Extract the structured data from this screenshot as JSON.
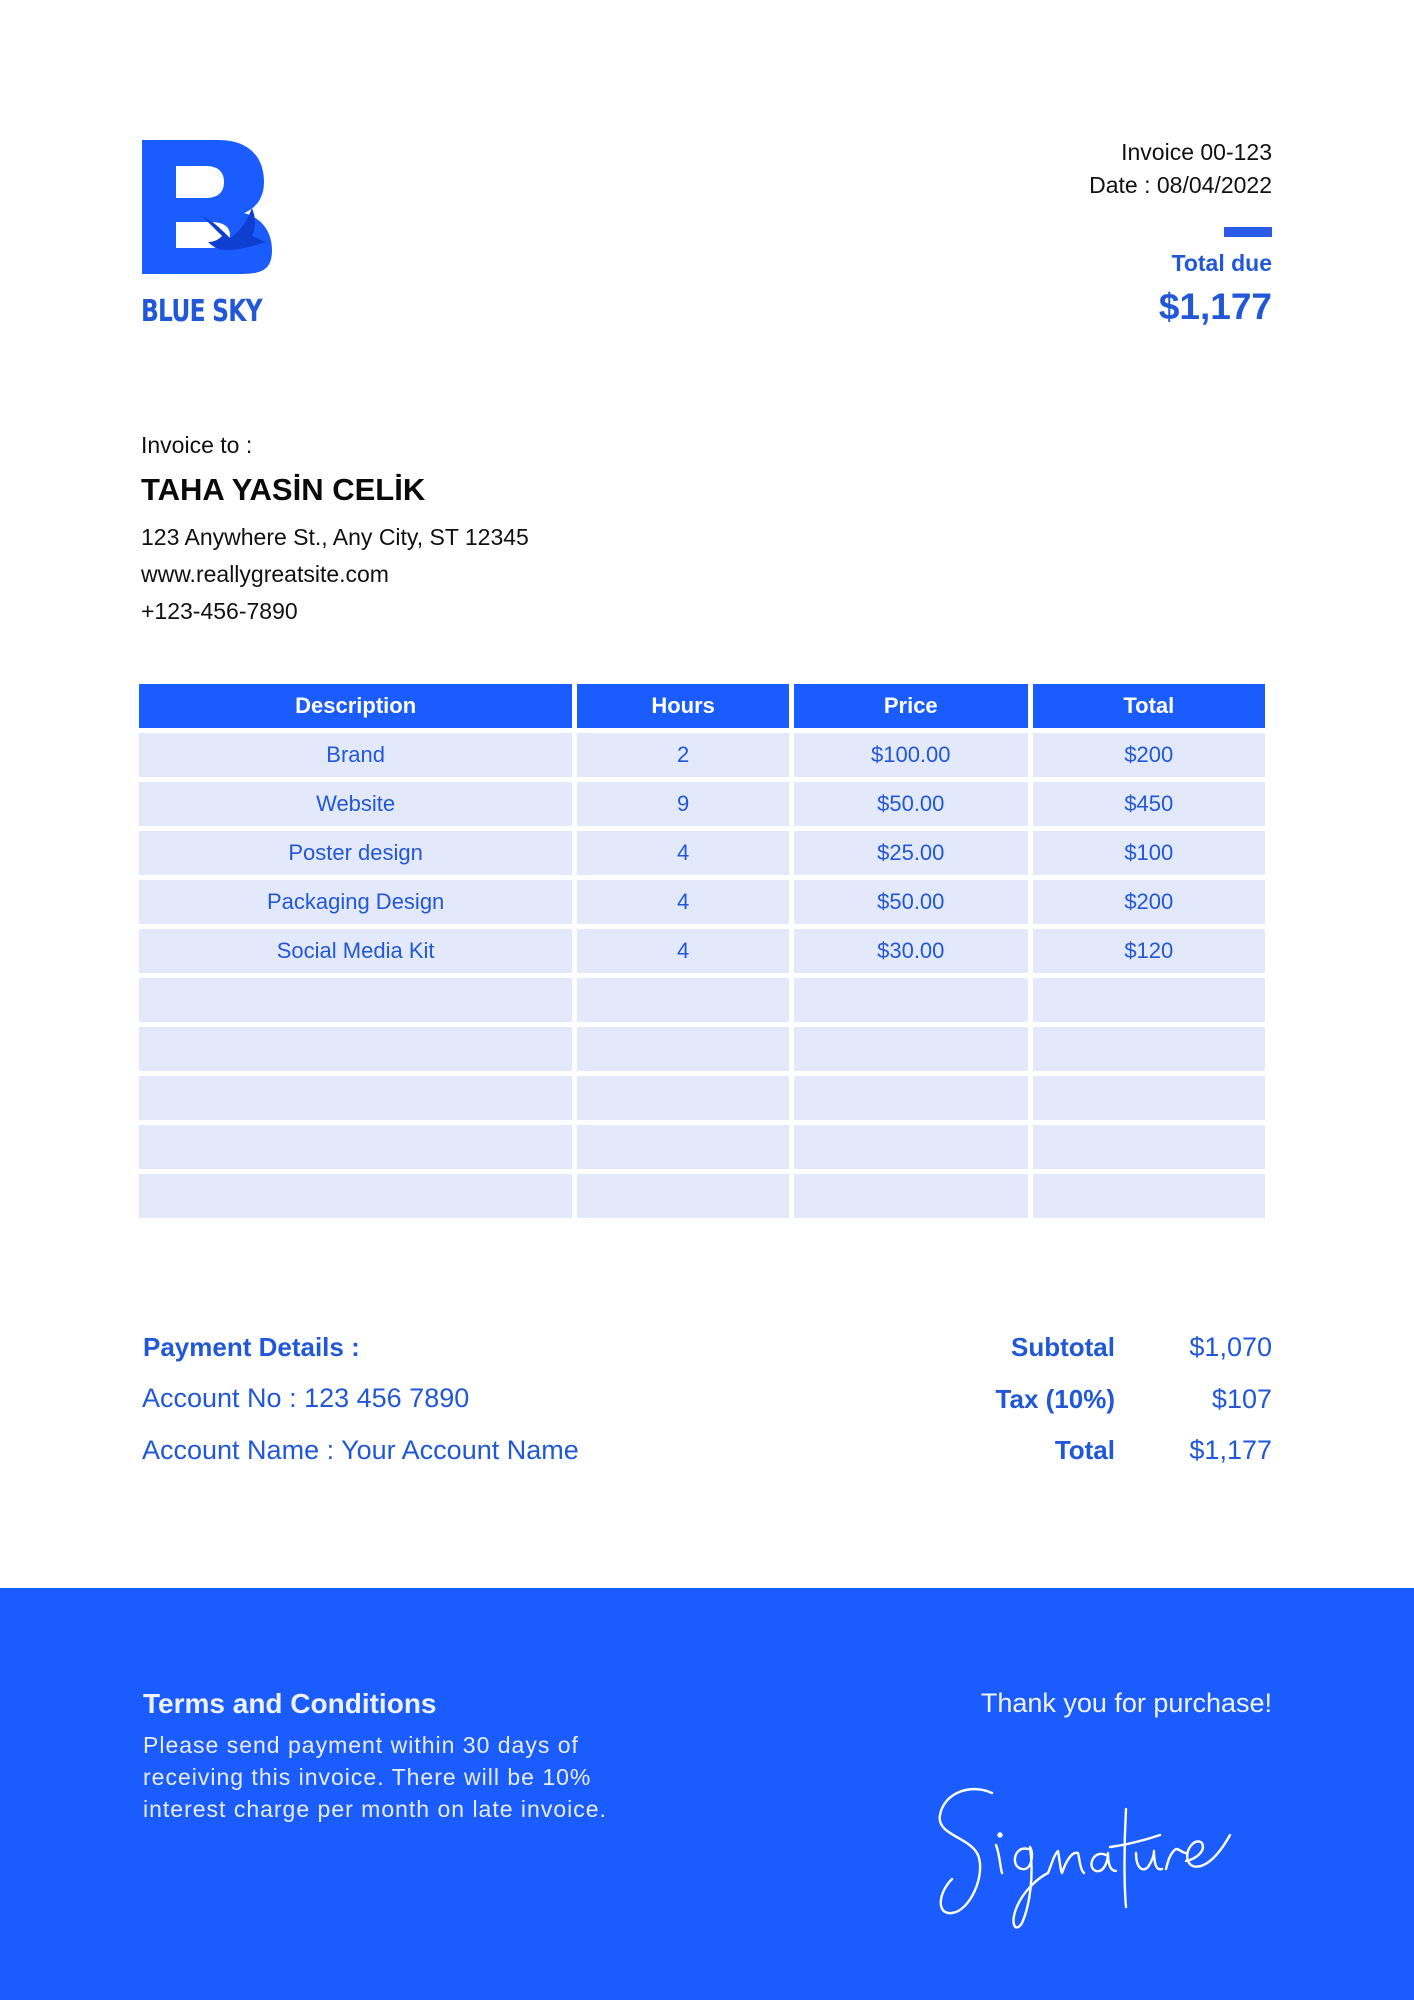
{
  "brand": {
    "name": "BLUE SKY",
    "logo_letter": "B",
    "logo_icon": "bird-icon",
    "color": "#1b5cff"
  },
  "invoice": {
    "number": "Invoice 00-123",
    "date": "Date : 08/04/2022",
    "total_due_label": "Total due",
    "total_due_value": "$1,177"
  },
  "bill_to": {
    "label": "Invoice to :",
    "name": "TAHA YASİN CELİK",
    "address": "123 Anywhere St., Any City, ST 12345",
    "website": "www.reallygreatsite.com",
    "phone": "+123-456-7890"
  },
  "table": {
    "headers": [
      "Description",
      "Hours",
      "Price",
      "Total"
    ],
    "rows": [
      [
        "Brand",
        "2",
        "$100.00",
        "$200"
      ],
      [
        "Website",
        "9",
        "$50.00",
        "$450"
      ],
      [
        "Poster design",
        "4",
        "$25.00",
        "$100"
      ],
      [
        "Packaging Design",
        "4",
        "$50.00",
        "$200"
      ],
      [
        "Social Media Kit",
        "4",
        "$30.00",
        "$120"
      ],
      [
        "",
        "",
        "",
        ""
      ],
      [
        "",
        "",
        "",
        ""
      ],
      [
        "",
        "",
        "",
        ""
      ],
      [
        "",
        "",
        "",
        ""
      ],
      [
        "",
        "",
        "",
        ""
      ]
    ],
    "header_color": "#1b5cff",
    "row_color": "#e4e8fb"
  },
  "payment": {
    "title": "Payment Details :",
    "account_no": "Account No : 123 456 7890",
    "account_name": "Account Name : Your Account Name"
  },
  "summary": {
    "subtotal_label": "Subtotal",
    "subtotal_value": "$1,070",
    "tax_label": "Tax (10%)",
    "tax_value": "$107",
    "total_label": "Total",
    "total_value": "$1,177"
  },
  "footer": {
    "terms_title": "Terms  and Conditions",
    "terms_text": "Please send payment within 30 days of receiving this invoice. There will be 10% interest charge per month on late invoice.",
    "thanks": "Thank you for purchase!",
    "signature_text": "Signature"
  }
}
